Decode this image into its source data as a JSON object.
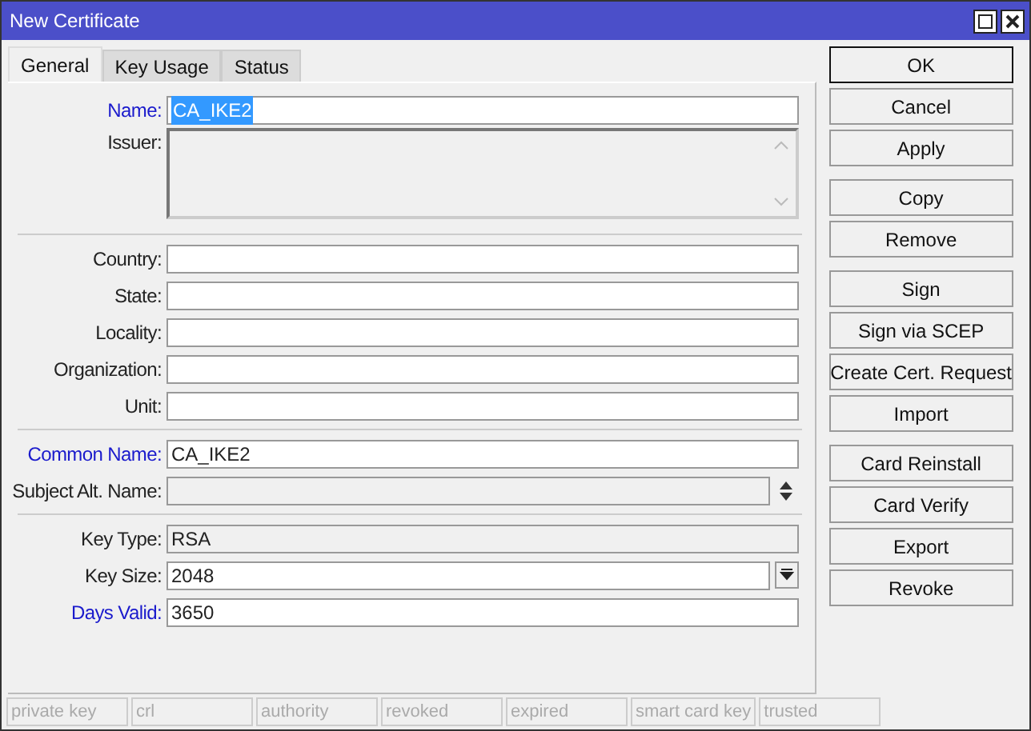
{
  "window": {
    "title": "New Certificate"
  },
  "tabs": [
    {
      "label": "General",
      "selected": true
    },
    {
      "label": "Key Usage",
      "selected": false
    },
    {
      "label": "Status",
      "selected": false
    }
  ],
  "sections": [
    {
      "fields": [
        {
          "kind": "text",
          "label": "Name:",
          "value": "CA_IKE2",
          "required": true,
          "value_selected": true
        },
        {
          "kind": "area",
          "label": "Issuer:",
          "disabled": true
        }
      ]
    },
    {
      "fields": [
        {
          "kind": "text",
          "label": "Country:"
        },
        {
          "kind": "text",
          "label": "State:"
        },
        {
          "kind": "text",
          "label": "Locality:"
        },
        {
          "kind": "text",
          "label": "Organization:"
        },
        {
          "kind": "text",
          "label": "Unit:"
        }
      ]
    },
    {
      "fields": [
        {
          "kind": "text",
          "label": "Common Name:",
          "value": "CA_IKE2",
          "required": true
        },
        {
          "kind": "list",
          "label": "Subject Alt. Name:",
          "disabled": true
        }
      ]
    },
    {
      "fields": [
        {
          "kind": "text",
          "label": "Key Type:",
          "value": "RSA",
          "disabled": true
        },
        {
          "kind": "dropdown",
          "label": "Key Size:",
          "value": "2048"
        },
        {
          "kind": "text",
          "label": "Days Valid:",
          "value": "3650",
          "required": true
        }
      ]
    }
  ],
  "button_groups": [
    [
      {
        "label": "OK",
        "default": true
      },
      {
        "label": "Cancel"
      },
      {
        "label": "Apply"
      }
    ],
    [
      {
        "label": "Copy"
      },
      {
        "label": "Remove"
      }
    ],
    [
      {
        "label": "Sign"
      },
      {
        "label": "Sign via SCEP"
      },
      {
        "label": "Create Cert. Request"
      },
      {
        "label": "Import"
      }
    ],
    [
      {
        "label": "Card Reinstall"
      },
      {
        "label": "Card Verify"
      },
      {
        "label": "Export"
      },
      {
        "label": "Revoke"
      }
    ]
  ],
  "status_bar": [
    "private key",
    "crl",
    "authority",
    "revoked",
    "expired",
    "smart card key",
    "trusted"
  ]
}
